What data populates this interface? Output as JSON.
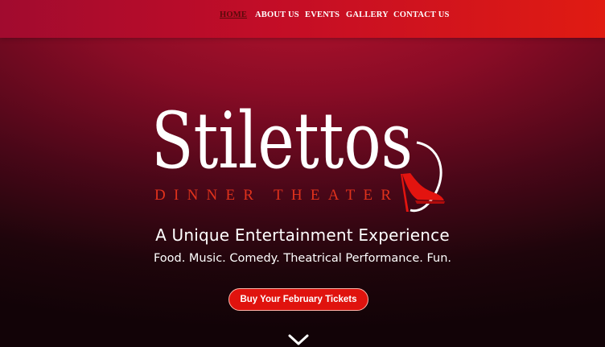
{
  "nav": {
    "items": [
      {
        "label": "HOME",
        "active": true
      },
      {
        "label": "ABOUT US",
        "active": false
      },
      {
        "label": "EVENTS",
        "active": false
      },
      {
        "label": "GALLERY",
        "active": false
      },
      {
        "label": "CONTACT US",
        "active": false
      }
    ]
  },
  "hero": {
    "logo_title": "Stilettos",
    "logo_subtitle": "DINNER THEATER",
    "tagline": "A Unique Entertainment Experience",
    "subline": "Food. Music. Comedy. Theatrical Performance. Fun.",
    "cta_label": "Buy Your February Tickets",
    "scroll_icon": "chevron-down-icon"
  },
  "colors": {
    "accent": "#e0130e",
    "topbar_start": "#a10b2f",
    "topbar_end": "#e01b12",
    "active_nav": "#5a0a0a",
    "logo_subtitle": "#e0321c"
  }
}
